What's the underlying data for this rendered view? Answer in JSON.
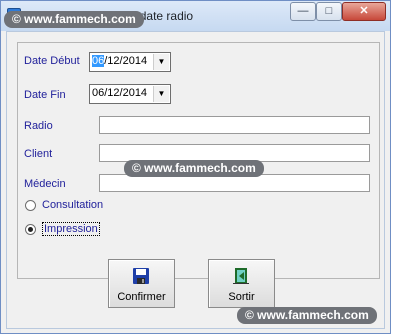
{
  "window": {
    "title": "Statistique Radio par date radio",
    "buttons": {
      "min": "—",
      "max": "□",
      "close": "✕"
    }
  },
  "form": {
    "date_debut": {
      "label": "Date Début",
      "value_selected": "06",
      "value_rest": "/12/2014"
    },
    "date_fin": {
      "label": "Date Fin",
      "value": "06/12/2014"
    },
    "radio": {
      "label": "Radio",
      "value": ""
    },
    "client": {
      "label": "Client",
      "value": ""
    },
    "medecin": {
      "label": "Médecin",
      "value": ""
    },
    "options": [
      {
        "label": "Consultation",
        "checked": false
      },
      {
        "label": "Impression",
        "checked": true
      }
    ]
  },
  "actions": {
    "confirm": "Confirmer",
    "exit": "Sortir"
  },
  "watermark": "© www.fammech.com",
  "icons": {
    "confirm": "floppy-disk-icon",
    "exit": "door-exit-icon",
    "dropdown": "dropdown-arrow-icon"
  }
}
